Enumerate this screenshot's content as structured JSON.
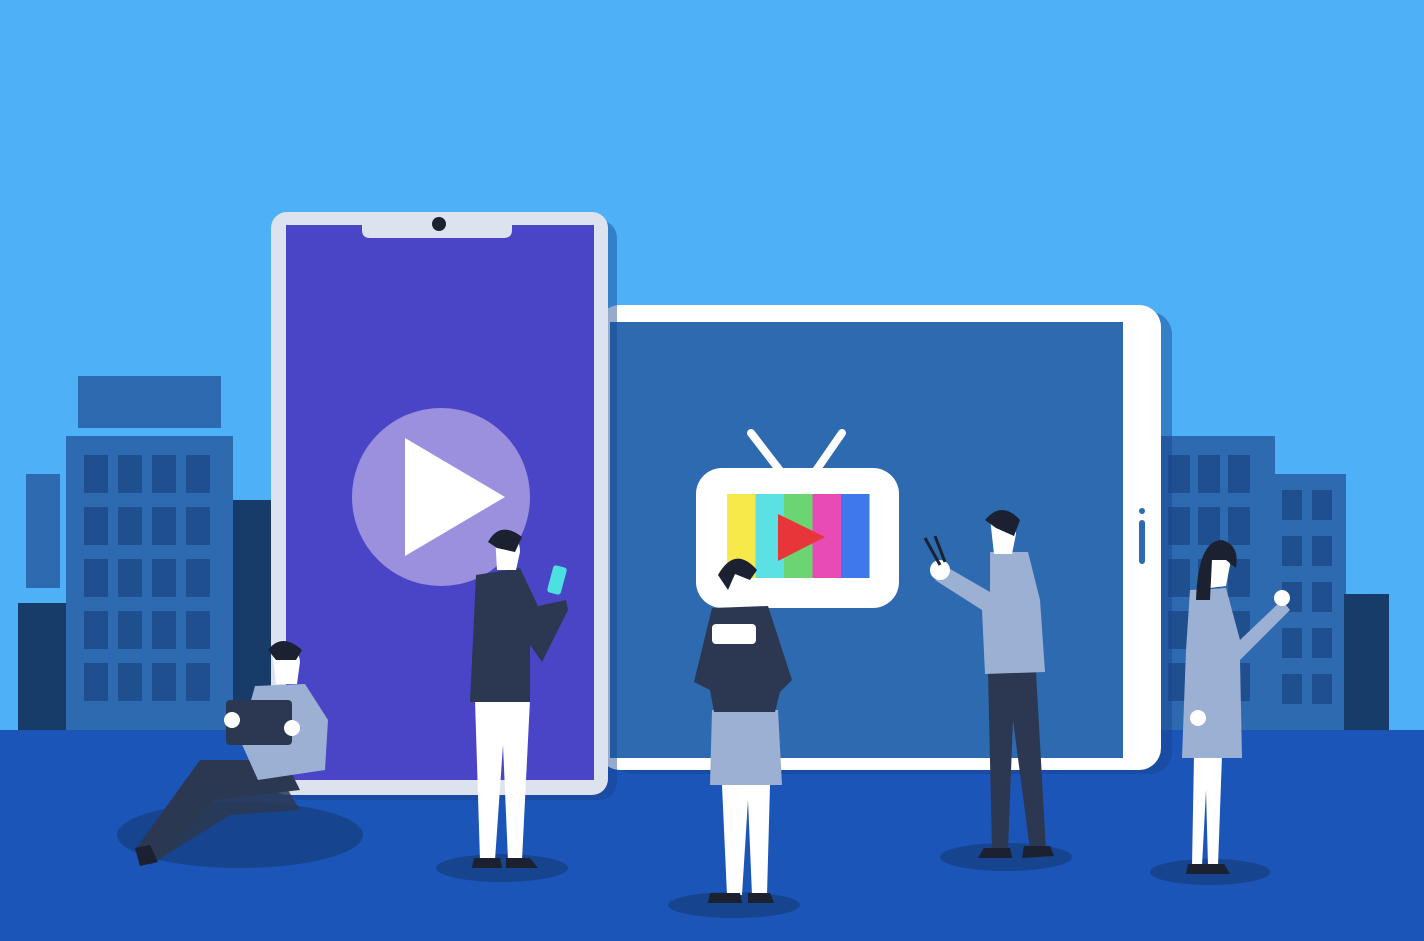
{
  "scene": {
    "description_icons": [
      "smartphone-icon",
      "tablet-icon",
      "tv-icon",
      "play-icon",
      "building-icon",
      "person-icon"
    ],
    "colors": {
      "sky": "#4EB1F8",
      "ground": "#1C55B8",
      "building": "#2D6AB0",
      "building_dark": "#183C6A",
      "window": "#1F4F8F",
      "phone_frame": "#DCE3EE",
      "phone_screen": "#4A45C6",
      "play_circle": "#9B90DE",
      "tablet_frame": "#FFFFFF",
      "tablet_screen": "#2D6AAF",
      "tv_body": "#FFFFFF",
      "tv_bars": [
        "#F7E94A",
        "#5BE0E4",
        "#6BD572",
        "#E94BB6",
        "#3F78EA"
      ],
      "tv_play": "#E7353A",
      "suit_dark": "#2C3851",
      "shirt_light": "#9BB0D3",
      "skin": "#FFFFFF",
      "hair": "#1B2130",
      "shadow": "#16448F"
    }
  }
}
